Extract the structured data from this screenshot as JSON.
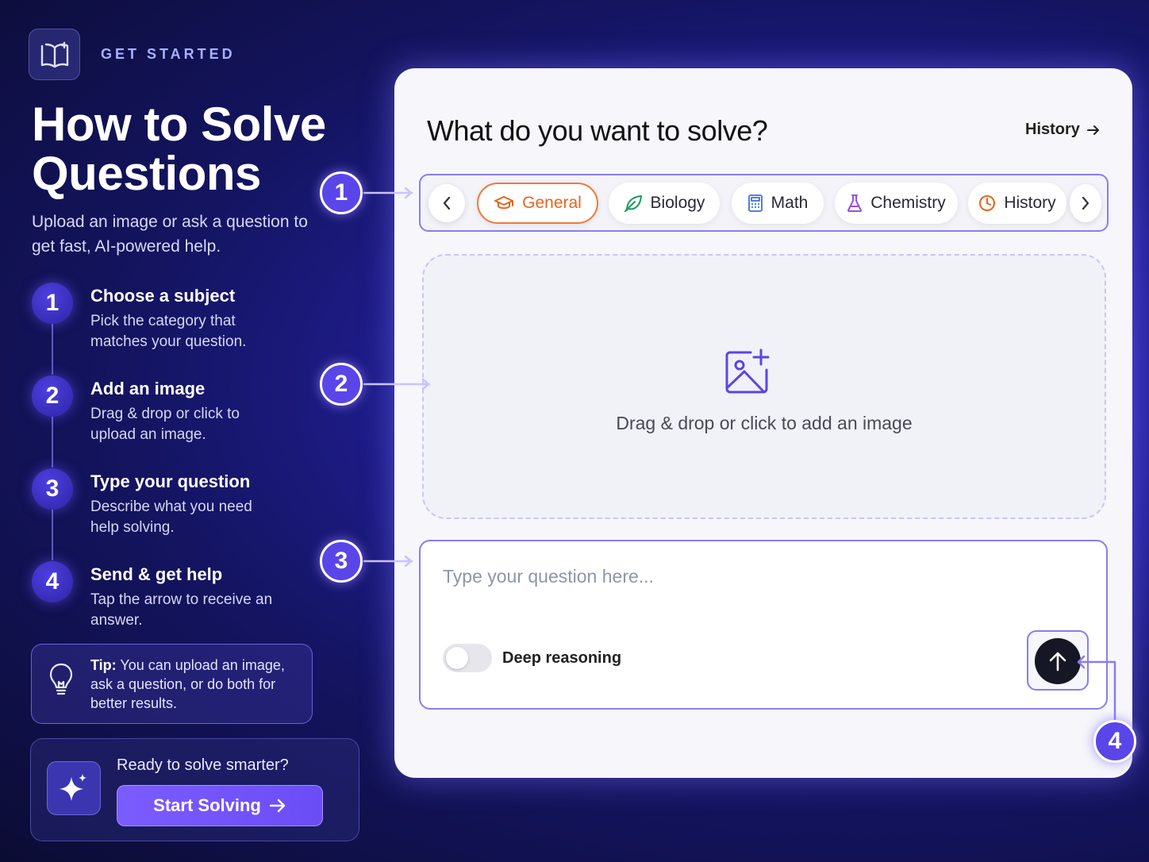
{
  "header": {
    "logo_icon": "book-icon",
    "eyebrow": "GET STARTED",
    "title": "How to Solve Questions",
    "subtitle": "Upload an image or ask a question to get fast, AI-powered help."
  },
  "steps": [
    {
      "number": "1",
      "title": "Choose a subject",
      "description": "Pick the category that matches your question."
    },
    {
      "number": "2",
      "title": "Add an image",
      "description": "Drag & drop or click to upload an image."
    },
    {
      "number": "3",
      "title": "Type your question",
      "description": "Describe what you need help solving."
    },
    {
      "number": "4",
      "title": "Send & get help",
      "description": "Tap the arrow to receive an answer."
    }
  ],
  "tip": {
    "icon": "lightbulb-icon",
    "label": "Tip:",
    "text": " You can upload an image, ask a question, or do both for better results."
  },
  "cta": {
    "icon": "sparkle-icon",
    "text": "Ready to solve smarter?",
    "button_label": "Start Solving"
  },
  "markers": [
    "1",
    "2",
    "3",
    "4"
  ],
  "panel": {
    "title": "What do you want to solve?",
    "history_link": "History",
    "subjects": [
      {
        "label": "General",
        "icon": "graduation-cap-icon",
        "active": true
      },
      {
        "label": "Biology",
        "icon": "leaf-icon",
        "active": false
      },
      {
        "label": "Math",
        "icon": "calculator-icon",
        "active": false
      },
      {
        "label": "Chemistry",
        "icon": "flask-icon",
        "active": false
      },
      {
        "label": "History",
        "icon": "clock-icon",
        "active": false
      }
    ],
    "dropzone_text": "Drag & drop or click to add an image",
    "question_placeholder": "Type your question here...",
    "question_value": "",
    "deep_reasoning_label": "Deep reasoning",
    "deep_reasoning_on": false
  },
  "colors": {
    "accent": "#5a45e8",
    "active_chip": "#e8641f",
    "panel_border": "#8b7cf0",
    "send_button": "#151724"
  }
}
